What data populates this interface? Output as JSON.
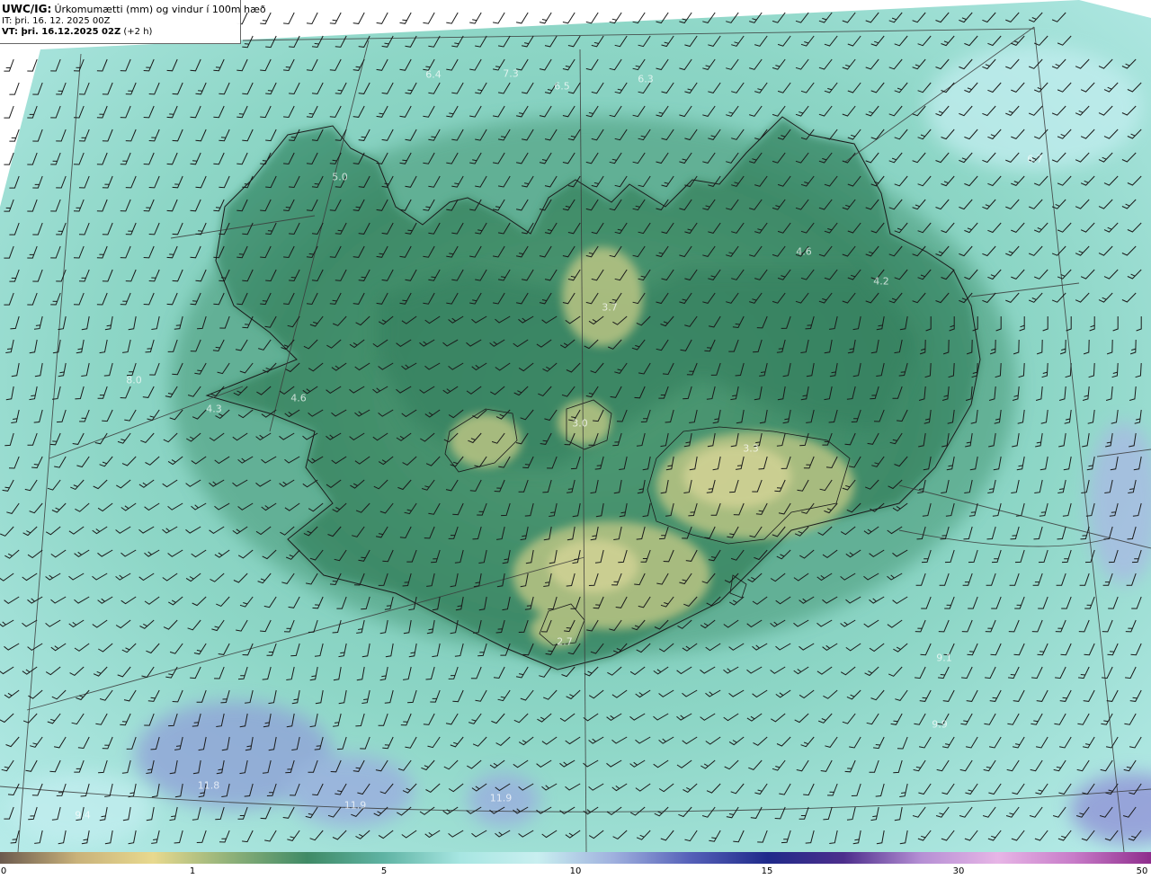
{
  "header": {
    "title_prefix": "UWC/IG:",
    "title_text": "Úrkomumætti (mm) og vindur í 100m hæð",
    "it_prefix": "IT:",
    "it_text": "þri. 16. 12. 2025 00Z",
    "vt_prefix": "VT: þri. 16.12.2025 02Z",
    "vt_suffix": "(+2 h)"
  },
  "map_labels": [
    {
      "text": "7.3"
    },
    {
      "text": "6.4"
    },
    {
      "text": "6.5"
    },
    {
      "text": "6.3"
    },
    {
      "text": "5.0"
    },
    {
      "text": "6.7"
    },
    {
      "text": "4.6"
    },
    {
      "text": "4.2"
    },
    {
      "text": "3.7"
    },
    {
      "text": "8.0"
    },
    {
      "text": "4.6"
    },
    {
      "text": "4.3"
    },
    {
      "text": "3.0"
    },
    {
      "text": "3.3"
    },
    {
      "text": "2.7"
    },
    {
      "text": "9.1"
    },
    {
      "text": "11.8"
    },
    {
      "text": "11.9"
    },
    {
      "text": "11.9"
    },
    {
      "text": "9.4"
    },
    {
      "text": "9.9"
    }
  ],
  "colorbar": {
    "ticks": [
      "0",
      "1",
      "5",
      "10",
      "15",
      "30",
      "50"
    ],
    "colors": [
      "#6b5a4e",
      "#c9b27a",
      "#e8d98e",
      "#8fb179",
      "#3f8a66",
      "#5fb3a3",
      "#a7e6e2",
      "#c9eff0",
      "#9fb0de",
      "#5560b8",
      "#1f2a8a",
      "#4d2e8c",
      "#b58fd4",
      "#e7b5e6",
      "#c77bc8",
      "#8e2c8c"
    ]
  }
}
